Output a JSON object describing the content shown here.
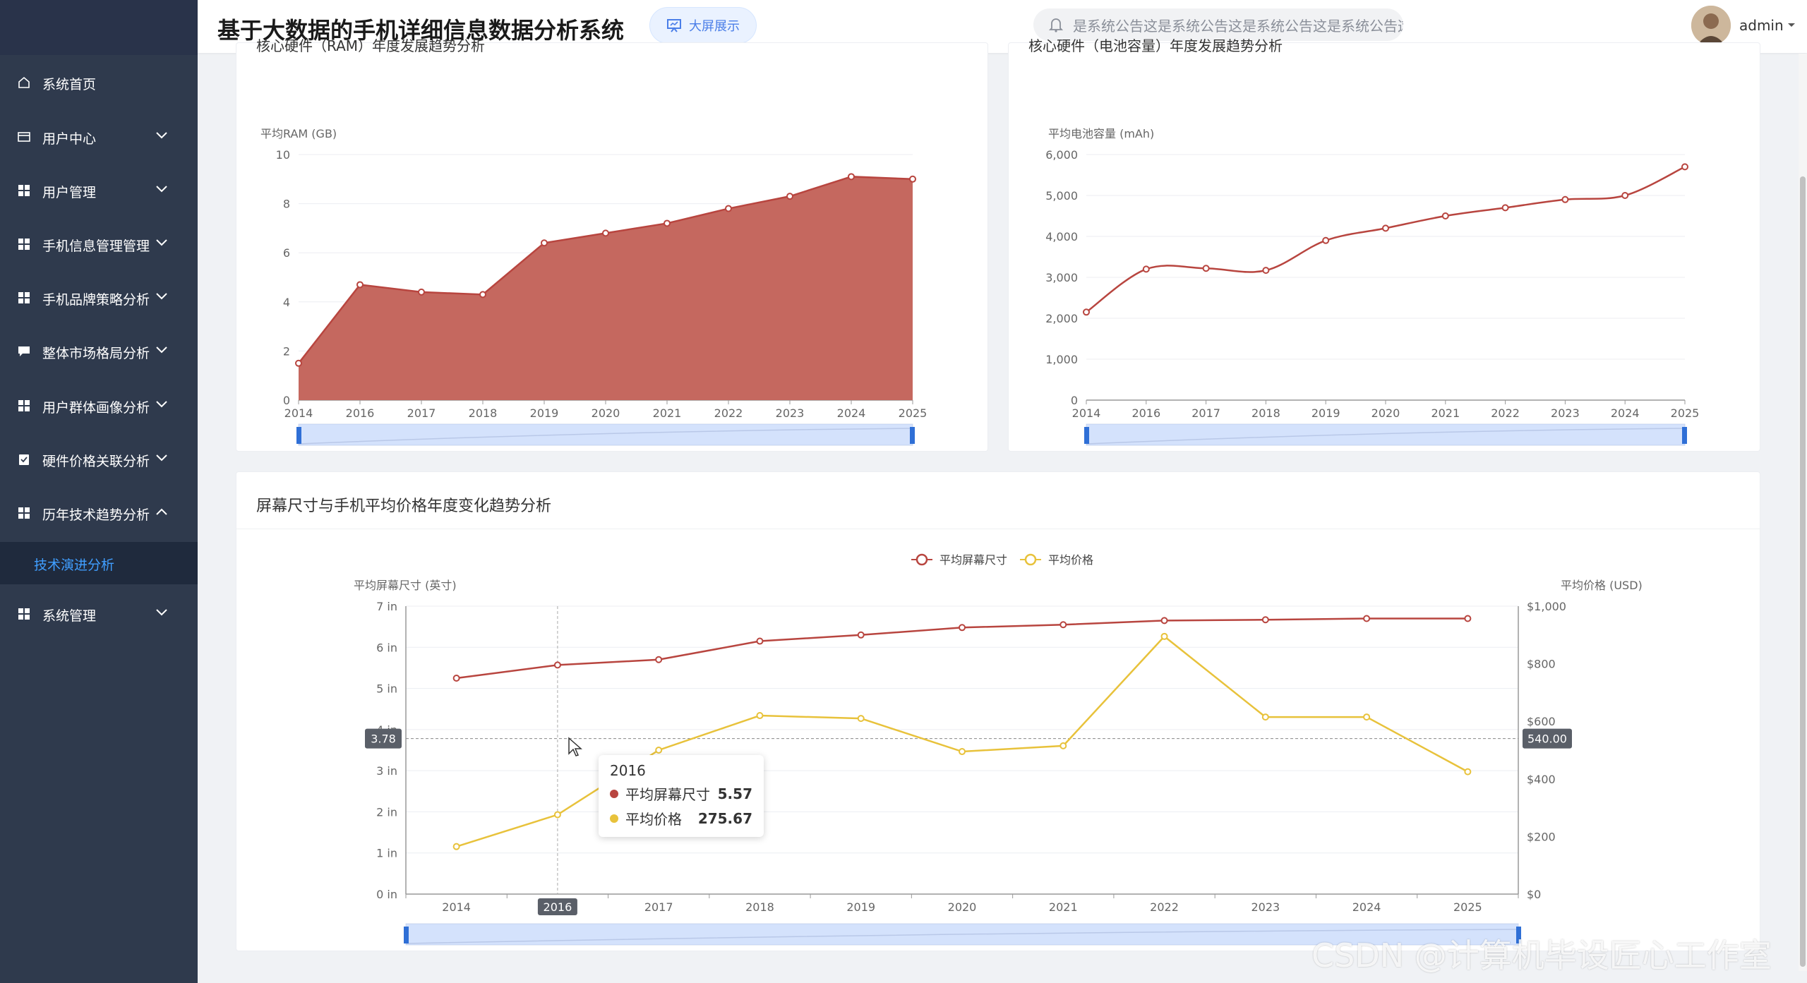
{
  "app": {
    "title": "基于大数据的手机详细信息数据分析系统",
    "bigscreen_label": "大屏展示",
    "notice_text": "是系统公告这是系统公告这是系统公告这是系统公告这是系统公告",
    "username": "admin"
  },
  "sidebar": {
    "items": [
      {
        "label": "系统首页",
        "icon": "home-icon",
        "expandable": false
      },
      {
        "label": "用户中心",
        "icon": "card-icon",
        "expandable": true
      },
      {
        "label": "用户管理",
        "icon": "grid-icon",
        "expandable": true
      },
      {
        "label": "手机信息管理管理",
        "icon": "grid-icon",
        "expandable": true
      },
      {
        "label": "手机品牌策略分析",
        "icon": "grid-icon",
        "expandable": true
      },
      {
        "label": "整体市场格局分析",
        "icon": "chat-icon",
        "expandable": true
      },
      {
        "label": "用户群体画像分析",
        "icon": "grid-icon",
        "expandable": true
      },
      {
        "label": "硬件价格关联分析",
        "icon": "clipboard-icon",
        "expandable": true
      },
      {
        "label": "历年技术趋势分析",
        "icon": "grid-icon",
        "expandable": true,
        "expanded": true
      },
      {
        "label": "系统管理",
        "icon": "grid-icon",
        "expandable": true
      }
    ],
    "active_sub": "技术演进分析"
  },
  "cards": {
    "ram_title": "核心硬件（RAM）年度发展趋势分析",
    "battery_title": "核心硬件（电池容量）年度发展趋势分析",
    "screen_title": "屏幕尺寸与手机平均价格年度变化趋势分析"
  },
  "colors": {
    "red": "#b8453f",
    "red_fill": "#c5685f",
    "yellow": "#e8c23b",
    "accent": "#409eff",
    "sidebar": "#2f3a4d"
  },
  "chart_data": [
    {
      "type": "area",
      "ylabel": "平均RAM (GB)",
      "x": [
        "2014",
        "2016",
        "2017",
        "2018",
        "2019",
        "2020",
        "2021",
        "2022",
        "2023",
        "2024",
        "2025"
      ],
      "y_ticks": [
        "0",
        "2",
        "4",
        "6",
        "8",
        "10"
      ],
      "values": [
        1.5,
        4.7,
        4.4,
        4.3,
        6.4,
        6.8,
        7.2,
        7.8,
        8.3,
        9.1,
        9.0
      ],
      "ylim": [
        0,
        10
      ]
    },
    {
      "type": "line",
      "ylabel": "平均电池容量 (mAh)",
      "x": [
        "2014",
        "2016",
        "2017",
        "2018",
        "2019",
        "2020",
        "2021",
        "2022",
        "2023",
        "2024",
        "2025"
      ],
      "y_ticks": [
        "0",
        "1,000",
        "2,000",
        "3,000",
        "4,000",
        "5,000",
        "6,000"
      ],
      "values": [
        2150,
        3200,
        3220,
        3170,
        3900,
        4200,
        4500,
        4700,
        4900,
        5000,
        5700
      ],
      "ylim": [
        0,
        6000
      ]
    },
    {
      "type": "line",
      "legend": [
        "平均屏幕尺寸",
        "平均价格"
      ],
      "ylabel_left": "平均屏幕尺寸 (英寸)",
      "ylabel_right": "平均价格 (USD)",
      "x": [
        "2014",
        "2016",
        "2017",
        "2018",
        "2019",
        "2020",
        "2021",
        "2022",
        "2023",
        "2024",
        "2025"
      ],
      "y_ticks_left": [
        "0 in",
        "1 in",
        "2 in",
        "3 in",
        "4 in",
        "5 in",
        "6 in",
        "7 in"
      ],
      "y_ticks_right": [
        "$0",
        "$200",
        "$400",
        "$600",
        "$800",
        "$1,000"
      ],
      "series": [
        {
          "name": "平均屏幕尺寸",
          "values": [
            5.25,
            5.57,
            5.7,
            6.15,
            6.3,
            6.48,
            6.55,
            6.65,
            6.67,
            6.7,
            6.7
          ]
        },
        {
          "name": "平均价格",
          "values": [
            165,
            275.67,
            500,
            620,
            610,
            495,
            515,
            895,
            615,
            615,
            425
          ]
        }
      ],
      "ylim_left": [
        0,
        7
      ],
      "ylim_right": [
        0,
        1000
      ],
      "crosshair": {
        "left_label": "3.78",
        "right_label": "540.00",
        "x_label": "2016"
      },
      "tooltip": {
        "title": "2016",
        "rows": [
          {
            "name": "平均屏幕尺寸",
            "value": "5.57"
          },
          {
            "name": "平均价格",
            "value": "275.67"
          }
        ]
      }
    }
  ],
  "watermark": "CSDN @计算机毕设匠心工作室"
}
